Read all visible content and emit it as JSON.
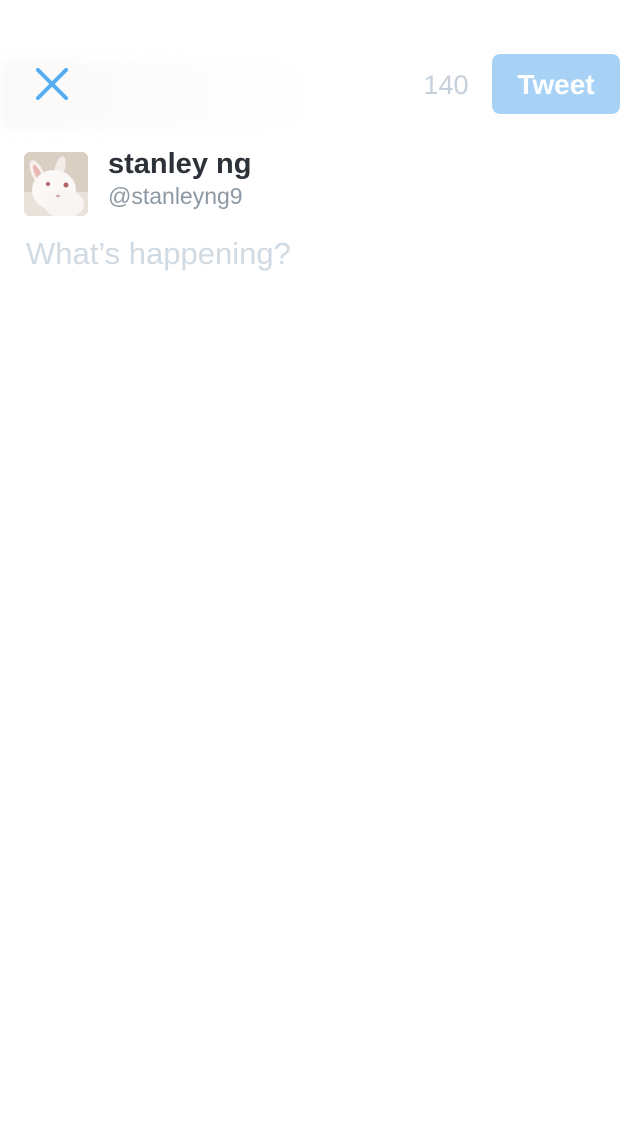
{
  "compose": {
    "close_icon": "close-icon",
    "char_count": "140",
    "tweet_label": "Tweet",
    "placeholder": "What’s happening?",
    "value": ""
  },
  "user": {
    "display_name": "stanley ng",
    "handle": "@stanleyng9",
    "avatar_icon": "rabbit-avatar"
  },
  "colors": {
    "accent": "#55acee",
    "tweet_button_disabled": "#a8d2f5",
    "counter_text": "#c6d0da",
    "placeholder_text": "#d0dae3",
    "name_text": "#2c3238",
    "handle_text": "#8c99a4"
  }
}
